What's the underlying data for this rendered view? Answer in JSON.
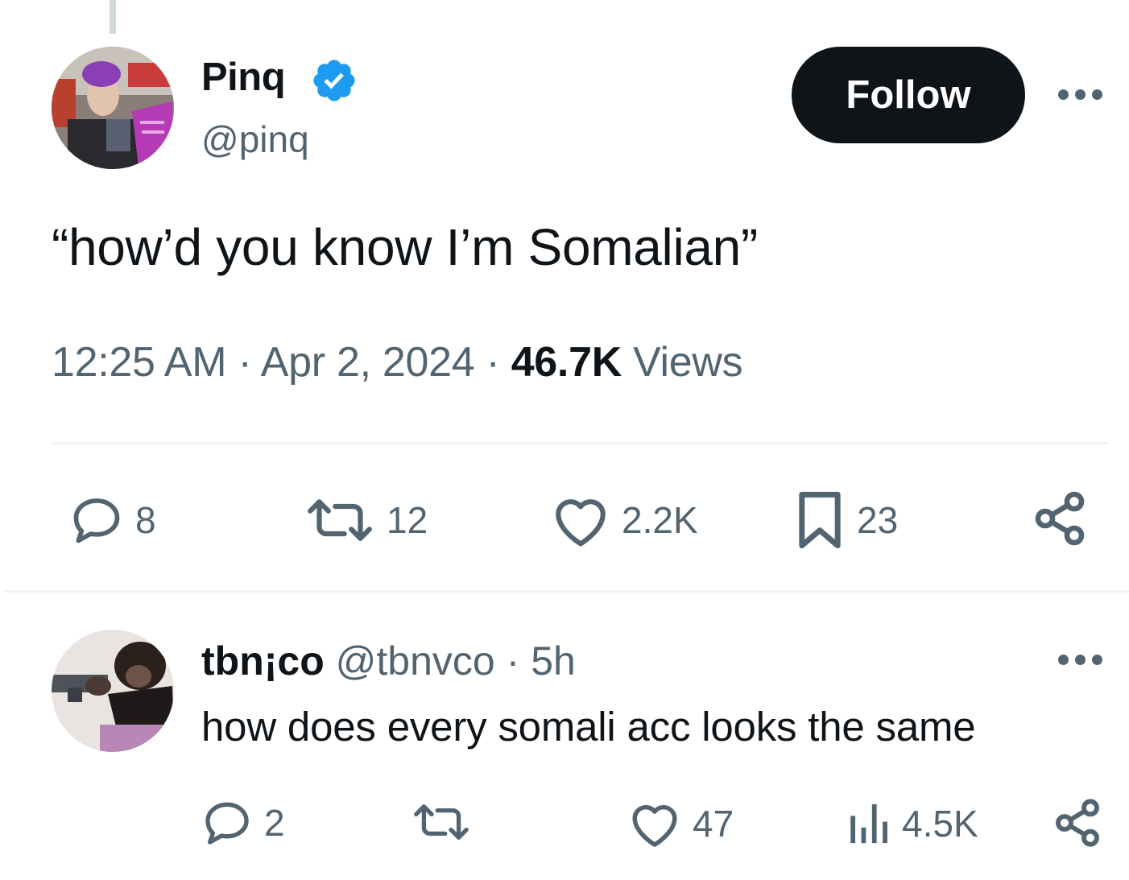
{
  "tweet": {
    "author_name": "Pinq",
    "author_handle": "@pinq",
    "follow_label": "Follow",
    "text": "“how’d you know I’m Somalian”",
    "time": "12:25 AM",
    "separator": "·",
    "date": "Apr 2, 2024",
    "views_count": "46.7K",
    "views_label": "Views",
    "actions": {
      "reply_count": "8",
      "repost_count": "12",
      "like_count": "2.2K",
      "bookmark_count": "23"
    }
  },
  "reply": {
    "author_name": "tbn¡co",
    "author_handle": "@tbnvco",
    "separator": "·",
    "time": "5h",
    "text": "how does every somali acc looks the same",
    "actions": {
      "reply_count": "2",
      "like_count": "47",
      "views_count": "4.5K"
    }
  },
  "colors": {
    "text": "#0f1419",
    "secondary": "#536471",
    "verified": "#1d9bf0",
    "divider": "#eff3f4",
    "follow_bg": "#0f1419"
  },
  "icons": [
    "verified-badge-icon",
    "more-icon",
    "reply-icon",
    "repost-icon",
    "like-icon",
    "bookmark-icon",
    "share-icon",
    "views-icon"
  ]
}
